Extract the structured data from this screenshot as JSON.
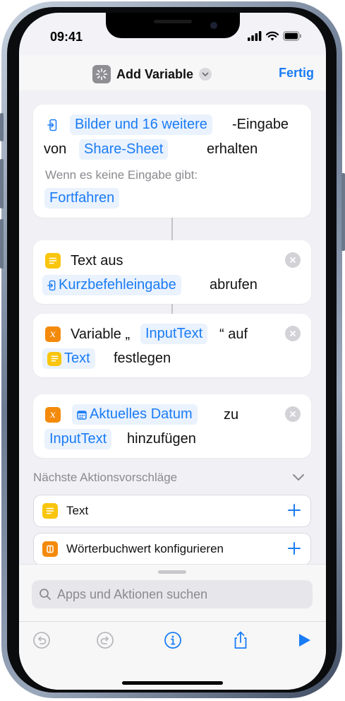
{
  "status": {
    "time": "09:41"
  },
  "header": {
    "title": "Add Variable",
    "done_label": "Fertig",
    "app_icon": "shortcut-icon"
  },
  "actions": [
    {
      "id": "receive-input",
      "token_input": "Bilder und 16 weitere",
      "text_eingabe": "-Eingabe",
      "text_von": "von",
      "token_source": "Share-Sheet",
      "text_erhalten": "erhalten",
      "no_input_label": "Wenn es keine Eingabe gibt:",
      "token_fallback": "Fortfahren"
    },
    {
      "id": "get-text",
      "text_text_aus": "Text aus",
      "token_source": "Kurzbefehleingabe",
      "text_abrufen": "abrufen"
    },
    {
      "id": "set-variable",
      "text_variable": "Variable „",
      "token_variable": "InputText",
      "text_auf": "“ auf",
      "token_value": "Text",
      "text_festlegen": "festlegen"
    },
    {
      "id": "add-to-variable",
      "token_value": "Aktuelles Datum",
      "text_zu": "zu",
      "token_variable": "InputText",
      "text_hinzufuegen": "hinzufügen"
    }
  ],
  "suggestions": {
    "title": "Nächste Aktionsvorschläge",
    "items": [
      {
        "label": "Text",
        "icon": "text-icon"
      },
      {
        "label": "Wörterbuchwert konfigurieren",
        "icon": "dictionary-icon"
      }
    ]
  },
  "search": {
    "placeholder": "Apps und Aktionen suchen"
  },
  "colors": {
    "accent": "#1a7cf5",
    "token_bg": "#eaf2fd",
    "yellow": "#f9c50d",
    "orange": "#f48a0c"
  }
}
